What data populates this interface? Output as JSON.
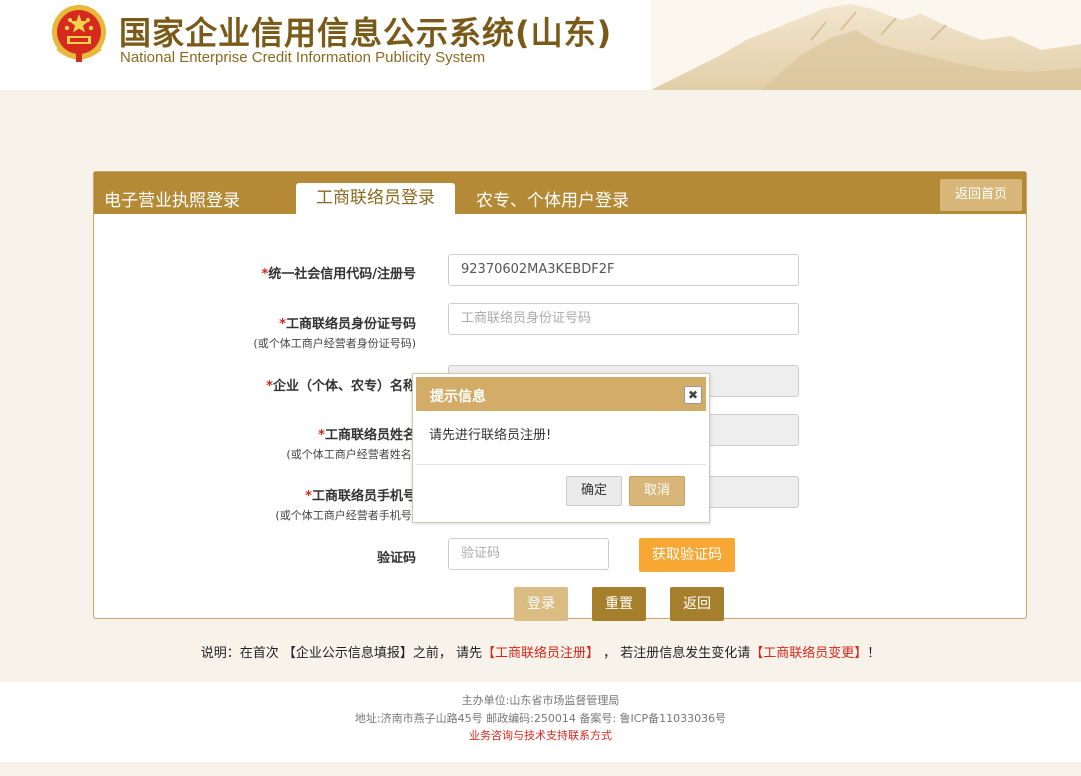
{
  "header": {
    "title": "国家企业信用信息公示系统(山东)",
    "subtitle": "National Enterprise Credit Information Publicity System"
  },
  "panel": {
    "tabs": [
      "电子营业执照登录",
      "工商联络员登录",
      "农专、个体用户登录"
    ],
    "active_tab": "工商联络员登录",
    "home_button": "返回首页"
  },
  "form": {
    "required_mark": "*",
    "fields": [
      {
        "label": "统一社会信用代码/注册号",
        "sublabel": "",
        "value": "92370602MA3KEBDF2F",
        "placeholder": ""
      },
      {
        "label": "工商联络员身份证号码",
        "sublabel": "(或个体工商户经营者身份证号码)",
        "value": "",
        "placeholder": "工商联络员身份证号码"
      },
      {
        "label": "企业（个体、农专）名称",
        "sublabel": "",
        "value": "",
        "placeholder": ""
      },
      {
        "label": "工商联络员姓名",
        "sublabel": "(或个体工商户经营者姓名)",
        "value": "",
        "placeholder": ""
      },
      {
        "label": "工商联络员手机号",
        "sublabel": "(或个体工商户经营者手机号)",
        "value": "",
        "placeholder": ""
      }
    ],
    "captcha_label": "验证码",
    "captcha_placeholder": "验证码",
    "get_code_button": "获取验证码",
    "login_button": "登录",
    "reset_button": "重置",
    "back_button": "返回"
  },
  "dialog": {
    "title": "提示信息",
    "close_icon": "close-icon",
    "message": "请先进行联络员注册!",
    "ok_button": "确定",
    "cancel_button": "取消"
  },
  "note": {
    "prefix": "说明：在首次 【企业公示信息填报】之前， 请先",
    "link1": "【工商联络员注册】",
    "middle": " ， 若注册信息发生变化请",
    "link2": "【工商联络员变更】",
    "suffix": "！"
  },
  "footer": {
    "sponsor": "主办单位:山东省市场监督管理局",
    "address": "地址:济南市燕子山路45号    邮政编码:250014    备案号: 鲁ICP备11033036号",
    "support": "业务咨询与技术支持联系方式"
  },
  "colors": {
    "brand": "#b58a36",
    "brand_light": "#d8b67a",
    "accent_orange": "#f6a734",
    "dark_gold": "#a67f2c",
    "required": "#d9261c"
  }
}
